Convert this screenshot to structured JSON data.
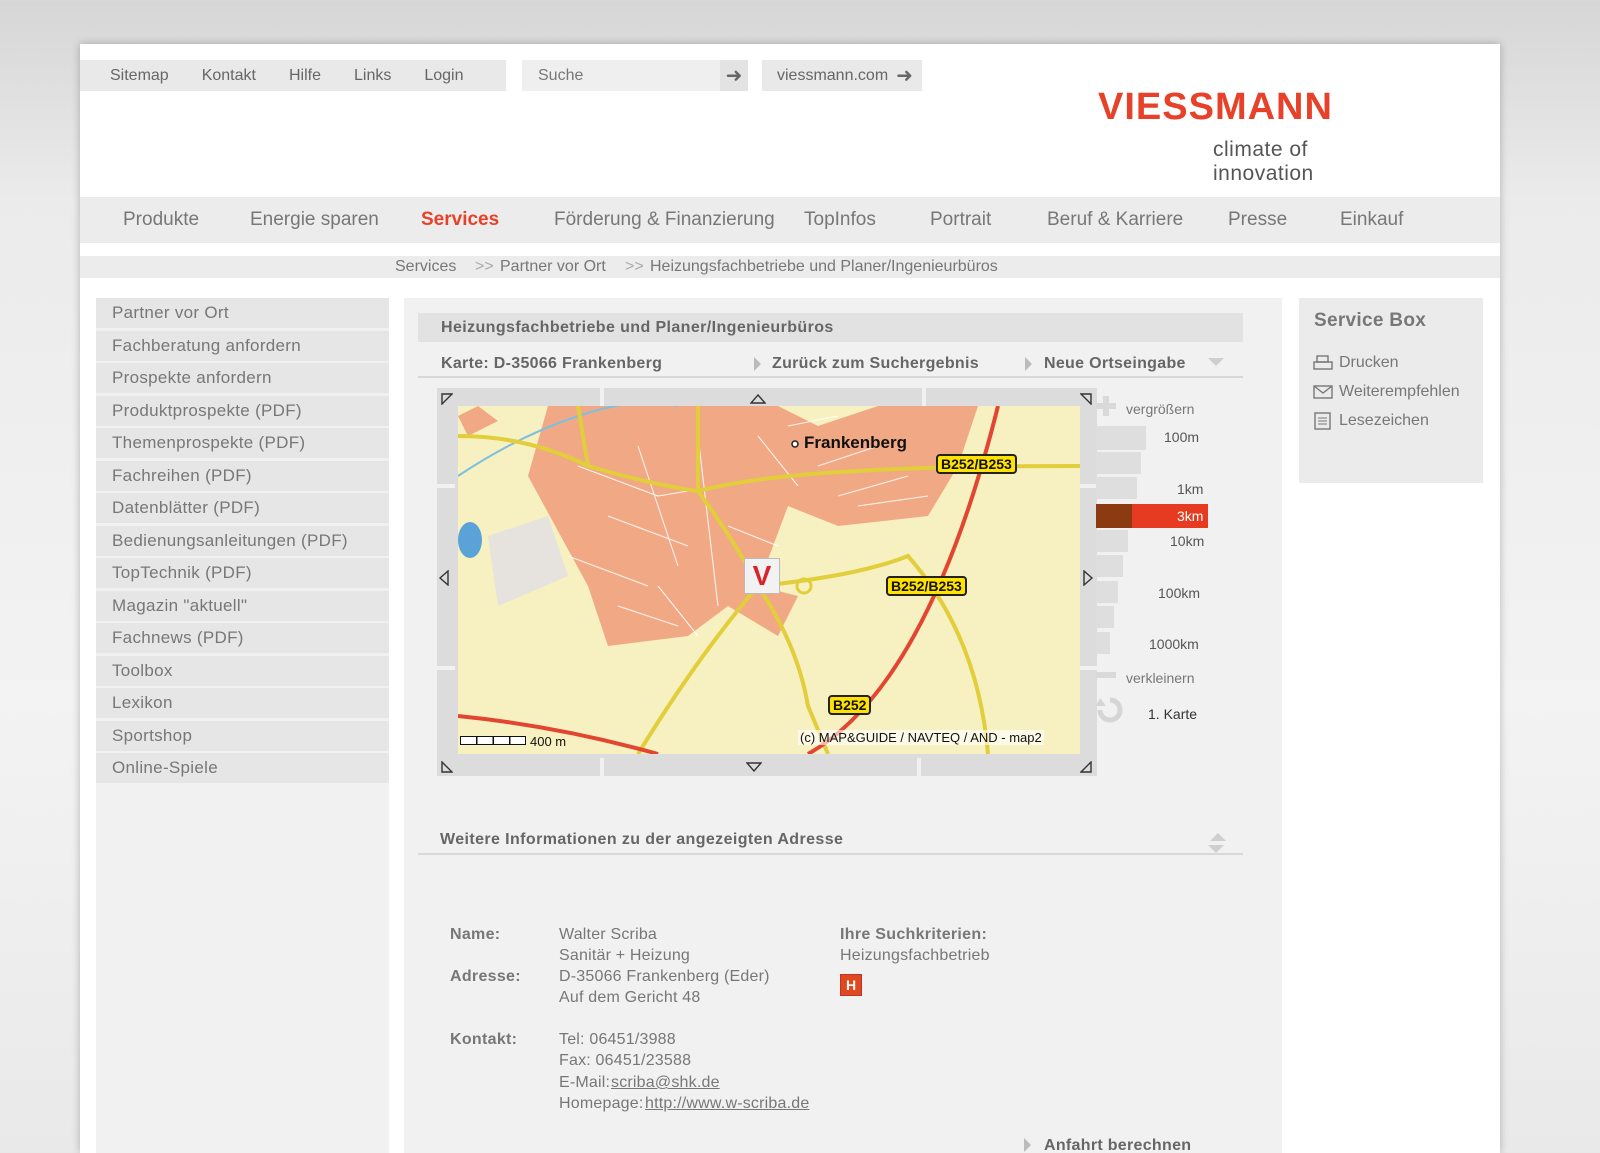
{
  "toplinks": [
    "Sitemap",
    "Kontakt",
    "Hilfe",
    "Links",
    "Login"
  ],
  "search": {
    "placeholder": "Suche",
    "go": "➜"
  },
  "site_link": {
    "label": "viessmann.com",
    "icon": "arrow-right-icon"
  },
  "logo": {
    "wordmark": "VIESSMANN",
    "tagline": "climate of innovation"
  },
  "mainnav": [
    "Produkte",
    "Energie sparen",
    "Services",
    "Förderung & Finanzierung",
    "TopInfos",
    "Portrait",
    "Beruf & Karriere",
    "Presse",
    "Einkauf"
  ],
  "active_nav": "Services",
  "breadcrumb": [
    "Services",
    "Partner vor Ort",
    "Heizungsfachbetriebe und Planer/Ingenieurbüros"
  ],
  "breadcrumb_sep": ">>",
  "sidebar": [
    "Partner vor Ort",
    "Fachberatung anfordern",
    "Prospekte anfordern",
    "Produktprospekte (PDF)",
    "Themenprospekte (PDF)",
    "Fachreihen (PDF)",
    "Datenblätter (PDF)",
    "Bedienungsanleitungen (PDF)",
    "TopTechnik (PDF)",
    "Magazin \"aktuell\"",
    "Fachnews (PDF)",
    "Toolbox",
    "Lexikon",
    "Sportshop",
    "Online-Spiele"
  ],
  "panel": {
    "title": "Heizungsfachbetriebe und Planer/Ingenieurbüros",
    "map_label": "Karte: D-35066 Frankenberg",
    "back_link": "Zurück zum Suchergebnis",
    "new_location": "Neue Ortseingabe"
  },
  "map": {
    "city": "Frankenberg",
    "roads": [
      "B252/B253",
      "B252/B253",
      "B252"
    ],
    "scale": "400 m",
    "copyright": "(c) MAP&GUIDE / NAVTEQ / AND - map2"
  },
  "zoom": {
    "zoom_in": "vergrößern",
    "levels": [
      "100m",
      "1km",
      "3km",
      "10km",
      "100km",
      "1000km"
    ],
    "selected": "3km",
    "zoom_out": "verkleinern",
    "reset": "1. Karte"
  },
  "service_box": {
    "title": "Service Box",
    "items": [
      {
        "label": "Drucken",
        "icon": "printer-icon"
      },
      {
        "label": "Weiterempfehlen",
        "icon": "envelope-icon"
      },
      {
        "label": "Lesezeichen",
        "icon": "document-icon"
      }
    ]
  },
  "info": {
    "title": "Weitere Informationen zu der angezeigten Adresse",
    "name_label": "Name:",
    "name": [
      "Walter Scriba",
      "Sanitär + Heizung"
    ],
    "address_label": "Adresse:",
    "address": [
      "D-35066 Frankenberg (Eder)",
      "Auf dem Gericht 48"
    ],
    "contact_label": "Kontakt:",
    "tel": "Tel: 06451/3988",
    "fax": "Fax: 06451/23588",
    "email_label": "E-Mail:",
    "email": "scriba@shk.de",
    "homepage_label": "Homepage:",
    "homepage": "http://www.w-scriba.de",
    "criteria_label": "Ihre Suchkriterien:",
    "criteria": "Heizungsfachbetrieb",
    "criteria_badge": "H",
    "route": "Anfahrt berechnen"
  },
  "colors": {
    "brand": "#e8412a",
    "zoom_selected": "#8b3a12"
  }
}
